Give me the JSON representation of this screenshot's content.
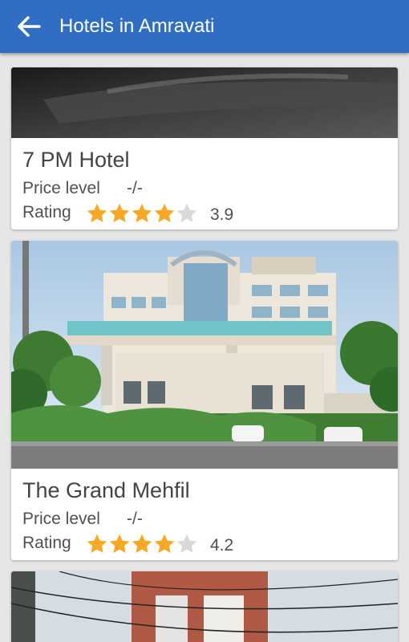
{
  "appbar": {
    "title": "Hotels in Amravati",
    "back_icon": "arrow-left-icon",
    "color": "#2f6ec3"
  },
  "labels": {
    "price": "Price level",
    "rating": "Rating"
  },
  "star_color": "#f7a825",
  "star_empty_color": "#d9d9d9",
  "hotels": [
    {
      "name": "7 PM Hotel",
      "price_level": "-/-",
      "rating": "3.9",
      "rating_value": 3.9,
      "filled_stars": 4
    },
    {
      "name": "The Grand Mehfil",
      "price_level": "-/-",
      "rating": "4.2",
      "rating_value": 4.2,
      "filled_stars": 4
    },
    {
      "name": "",
      "price_level": "",
      "rating": ""
    }
  ]
}
